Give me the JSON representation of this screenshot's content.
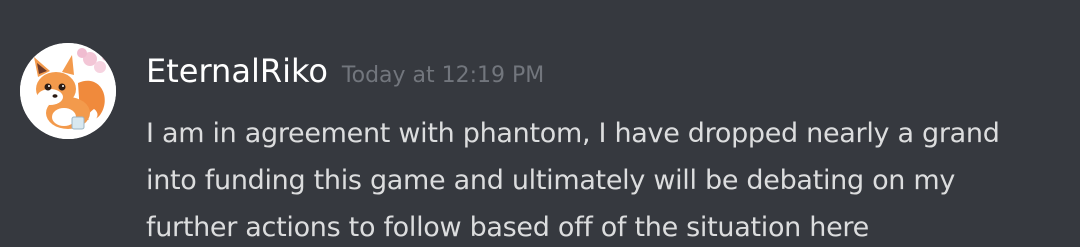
{
  "message": {
    "author": "EternalRiko",
    "timestamp": "Today at 12:19 PM",
    "lines": [
      "I am in agreement with phantom, I have dropped nearly a grand",
      "into funding this game and ultimately will be debating on my",
      "further actions to follow based off of the situation here"
    ],
    "avatar_icon": "fox-avatar-icon"
  },
  "colors": {
    "background": "#36393f",
    "username": "#ffffff",
    "timestamp": "#72767d",
    "text": "#dcddde"
  }
}
